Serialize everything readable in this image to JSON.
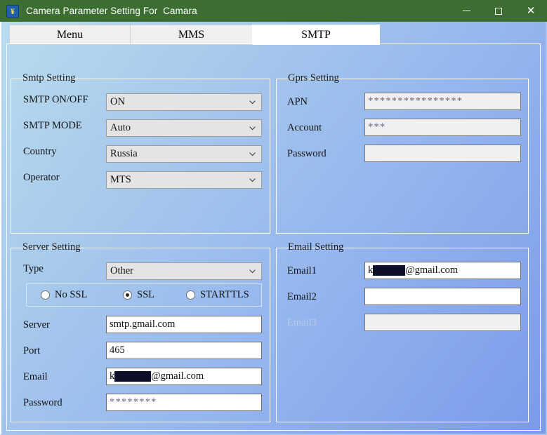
{
  "window": {
    "title": "Camera Parameter Setting For  Camara",
    "icon": "app-logo-icon",
    "icon_glyph": "¥",
    "controls": {
      "minimize": "minimize-icon",
      "maximize": "maximize-icon",
      "close": "✕"
    },
    "titlebar_color": "#3c6e32"
  },
  "tabs": [
    {
      "label": "Menu",
      "active": false
    },
    {
      "label": "MMS",
      "active": false
    },
    {
      "label": "SMTP",
      "active": true
    }
  ],
  "groups": {
    "smtp_setting": {
      "legend": "Smtp Setting",
      "fields": [
        {
          "label": "SMTP ON/OFF",
          "value": "ON",
          "type": "combo"
        },
        {
          "label": "SMTP MODE",
          "value": "Auto",
          "type": "combo"
        },
        {
          "label": "Country",
          "value": "Russia",
          "type": "combo"
        },
        {
          "label": "Operator",
          "value": "MTS",
          "type": "combo"
        }
      ]
    },
    "gprs_setting": {
      "legend": "Gprs Setting",
      "fields": [
        {
          "label": "APN",
          "value": "****************",
          "type": "text",
          "readonly": true,
          "masked": true
        },
        {
          "label": "Account",
          "value": "***",
          "type": "text",
          "readonly": true,
          "masked": true
        },
        {
          "label": "Password",
          "value": "",
          "type": "text",
          "readonly": true,
          "masked": false
        }
      ]
    },
    "server_setting": {
      "legend": "Server Setting",
      "type_field": {
        "label": "Type",
        "value": "Other"
      },
      "ssl_options": [
        {
          "label": "No SSL",
          "selected": false
        },
        {
          "label": "SSL",
          "selected": true
        },
        {
          "label": "STARTTLS",
          "selected": false
        }
      ],
      "fields": [
        {
          "label": "Server",
          "value": "smtp.gmail.com",
          "redacted": false
        },
        {
          "label": "Port",
          "value": "465",
          "redacted": false
        },
        {
          "label": "Email",
          "value_prefix": "k",
          "value_suffix": "@gmail.com",
          "redacted": true
        },
        {
          "label": "Password",
          "value": "********",
          "redacted": false,
          "masked": true
        }
      ]
    },
    "email_setting": {
      "legend": "Email Setting",
      "fields": [
        {
          "label": "Email1",
          "value_prefix": "k",
          "value_suffix": "@gmail.com",
          "redacted": true,
          "disabled": false
        },
        {
          "label": "Email2",
          "value": "",
          "redacted": false,
          "disabled": false
        },
        {
          "label": "Email3",
          "value": "",
          "redacted": false,
          "disabled": true
        }
      ]
    }
  },
  "colors": {
    "titlebar": "#3c6e32",
    "client_gradient_start": "#b8dbef",
    "client_gradient_end": "#7a9bea",
    "active_tab": "#ffffff",
    "inactive_tab": "#f0f0f0",
    "redaction": "#0d0f28"
  }
}
